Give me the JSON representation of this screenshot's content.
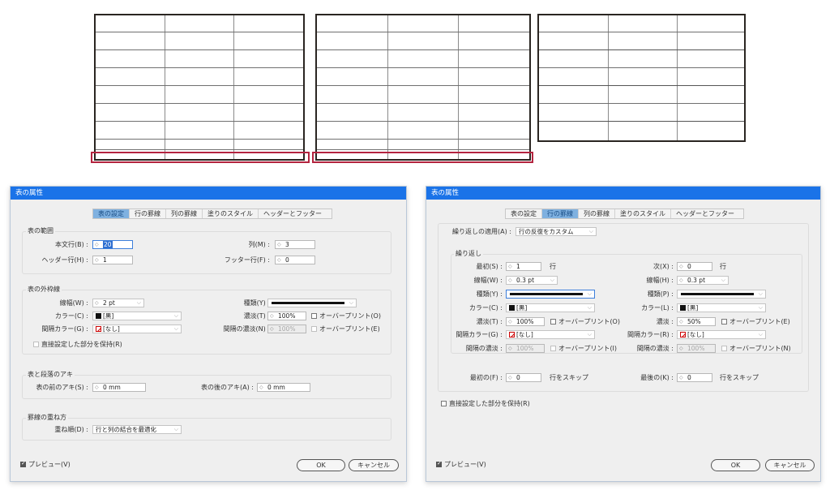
{
  "dialog1": {
    "title": "表の属性",
    "tabs": [
      "表の設定",
      "行の罫線",
      "列の罫線",
      "塗りのスタイル",
      "ヘッダーとフッター"
    ],
    "active_tab": "表の設定",
    "range": {
      "title": "表の範囲",
      "body_rows_label": "本文行(B) :",
      "body_rows_value": "20",
      "columns_label": "列(M) :",
      "columns_value": "3",
      "header_rows_label": "ヘッダー行(H) :",
      "header_rows_value": "1",
      "footer_rows_label": "フッター行(F) :",
      "footer_rows_value": "0"
    },
    "border": {
      "title": "表の外枠線",
      "weight_label": "線幅(W) :",
      "weight_value": "2 pt",
      "type_label": "種類(Y) :",
      "color_label": "カラー(C) :",
      "color_value": "[黒]",
      "tint_label": "濃淡(T) :",
      "tint_value": "100%",
      "overprint_label": "オーバープリント(O)",
      "gap_color_label": "間隔カラー(G) :",
      "gap_color_value": "[なし]",
      "gap_tint_label": "間隔の濃淡(N) :",
      "gap_tint_value": "100%",
      "gap_overprint_label": "オーバープリント(E)",
      "preserve_label": "直接設定した部分を保持(R)"
    },
    "spacing": {
      "title": "表と段落のアキ",
      "before_label": "表の前のアキ(S) :",
      "before_value": "0 mm",
      "after_label": "表の後のアキ(A) :",
      "after_value": "0 mm"
    },
    "draw_order": {
      "title": "罫線の重ね方",
      "label": "重ね順(D) :",
      "value": "行と列の結合を最適化"
    },
    "preview_label": "プレビュー(V)",
    "ok_label": "OK",
    "cancel_label": "キャンセル"
  },
  "dialog2": {
    "title": "表の属性",
    "tabs": [
      "表の設定",
      "行の罫線",
      "列の罫線",
      "塗りのスタイル",
      "ヘッダーとフッター"
    ],
    "active_tab": "行の罫線",
    "alternate_label": "繰り返しの適用(A) :",
    "alternate_value": "行の反復をカスタム",
    "repeat_title": "繰り返し",
    "first_label": "最初(S) :",
    "first_value": "1",
    "first_unit": "行",
    "next_label": "次(X) :",
    "next_value": "0",
    "next_unit": "行",
    "weight_w_label": "線幅(W) :",
    "weight_w_value": "0.3 pt",
    "weight_h_label": "線幅(H) :",
    "weight_h_value": "0.3 pt",
    "type_y_label": "種類(Y) :",
    "type_p_label": "種類(P) :",
    "color_c_label": "カラー(C) :",
    "color_c_value": "[黒]",
    "color_l_label": "カラー(L) :",
    "color_l_value": "[黒]",
    "tint_t_label": "濃淡(T) :",
    "tint_t_value": "100%",
    "overprint_o_label": "オーバープリント(O)",
    "tint_2_label": "濃淡 :",
    "tint_2_value": "50%",
    "overprint_e_label": "オーバープリント(E)",
    "gap_color_g_label": "間隔カラー(G) :",
    "gap_color_g_value": "[なし]",
    "gap_color_r_label": "間隔カラー(R) :",
    "gap_color_r_value": "[なし]",
    "gap_tint_1_label": "間隔の濃淡 :",
    "gap_tint_1_value": "100%",
    "overprint_i_label": "オーバープリント(I)",
    "gap_tint_2_label": "間隔の濃淡 :",
    "gap_tint_2_value": "100%",
    "overprint_n_label": "オーバープリント(N)",
    "skip_first_label": "最初の(F) :",
    "skip_first_value": "0",
    "skip_first_unit": "行をスキップ",
    "skip_last_label": "最後の(K) :",
    "skip_last_value": "0",
    "skip_last_unit": "行をスキップ",
    "preserve_label": "直接設定した部分を保持(R)",
    "preview_label": "プレビュー(V)",
    "ok_label": "OK",
    "cancel_label": "キャンセル"
  },
  "colors": {
    "title_bar": "#1a73e8",
    "active_tab": "#7fb1e0",
    "highlight": "#b3243f",
    "table_border": "#2a2521"
  }
}
